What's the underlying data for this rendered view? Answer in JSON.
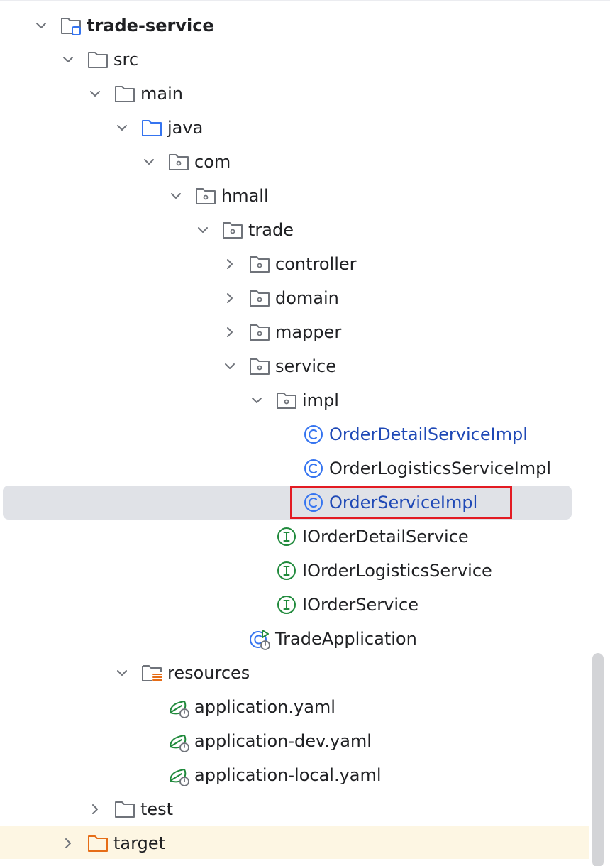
{
  "tree": {
    "module": "trade-service",
    "src": "src",
    "main": "main",
    "java": "java",
    "com": "com",
    "hmall": "hmall",
    "trade": "trade",
    "controller": "controller",
    "domain": "domain",
    "mapper": "mapper",
    "service": "service",
    "impl": "impl",
    "order_detail_service_impl": "OrderDetailServiceImpl",
    "order_logistics_service_impl": "OrderLogisticsServiceImpl",
    "order_service_impl": "OrderServiceImpl",
    "i_order_detail_service": "IOrderDetailService",
    "i_order_logistics_service": "IOrderLogisticsService",
    "i_order_service": "IOrderService",
    "trade_application": "TradeApplication",
    "resources": "resources",
    "application_yaml": "application.yaml",
    "application_dev_yaml": "application-dev.yaml",
    "application_local_yaml": "application-local.yaml",
    "test": "test",
    "target": "target"
  },
  "colors": {
    "folder_gray": "#6f737a",
    "source_folder_blue": "#3574f0",
    "class_blue": "#1f49b6",
    "interface_green": "#208a3c",
    "resources_orange": "#e66d17",
    "target_orange": "#e66d17",
    "selection": "#e0e2e7",
    "highlight_box": "#e31b23"
  }
}
